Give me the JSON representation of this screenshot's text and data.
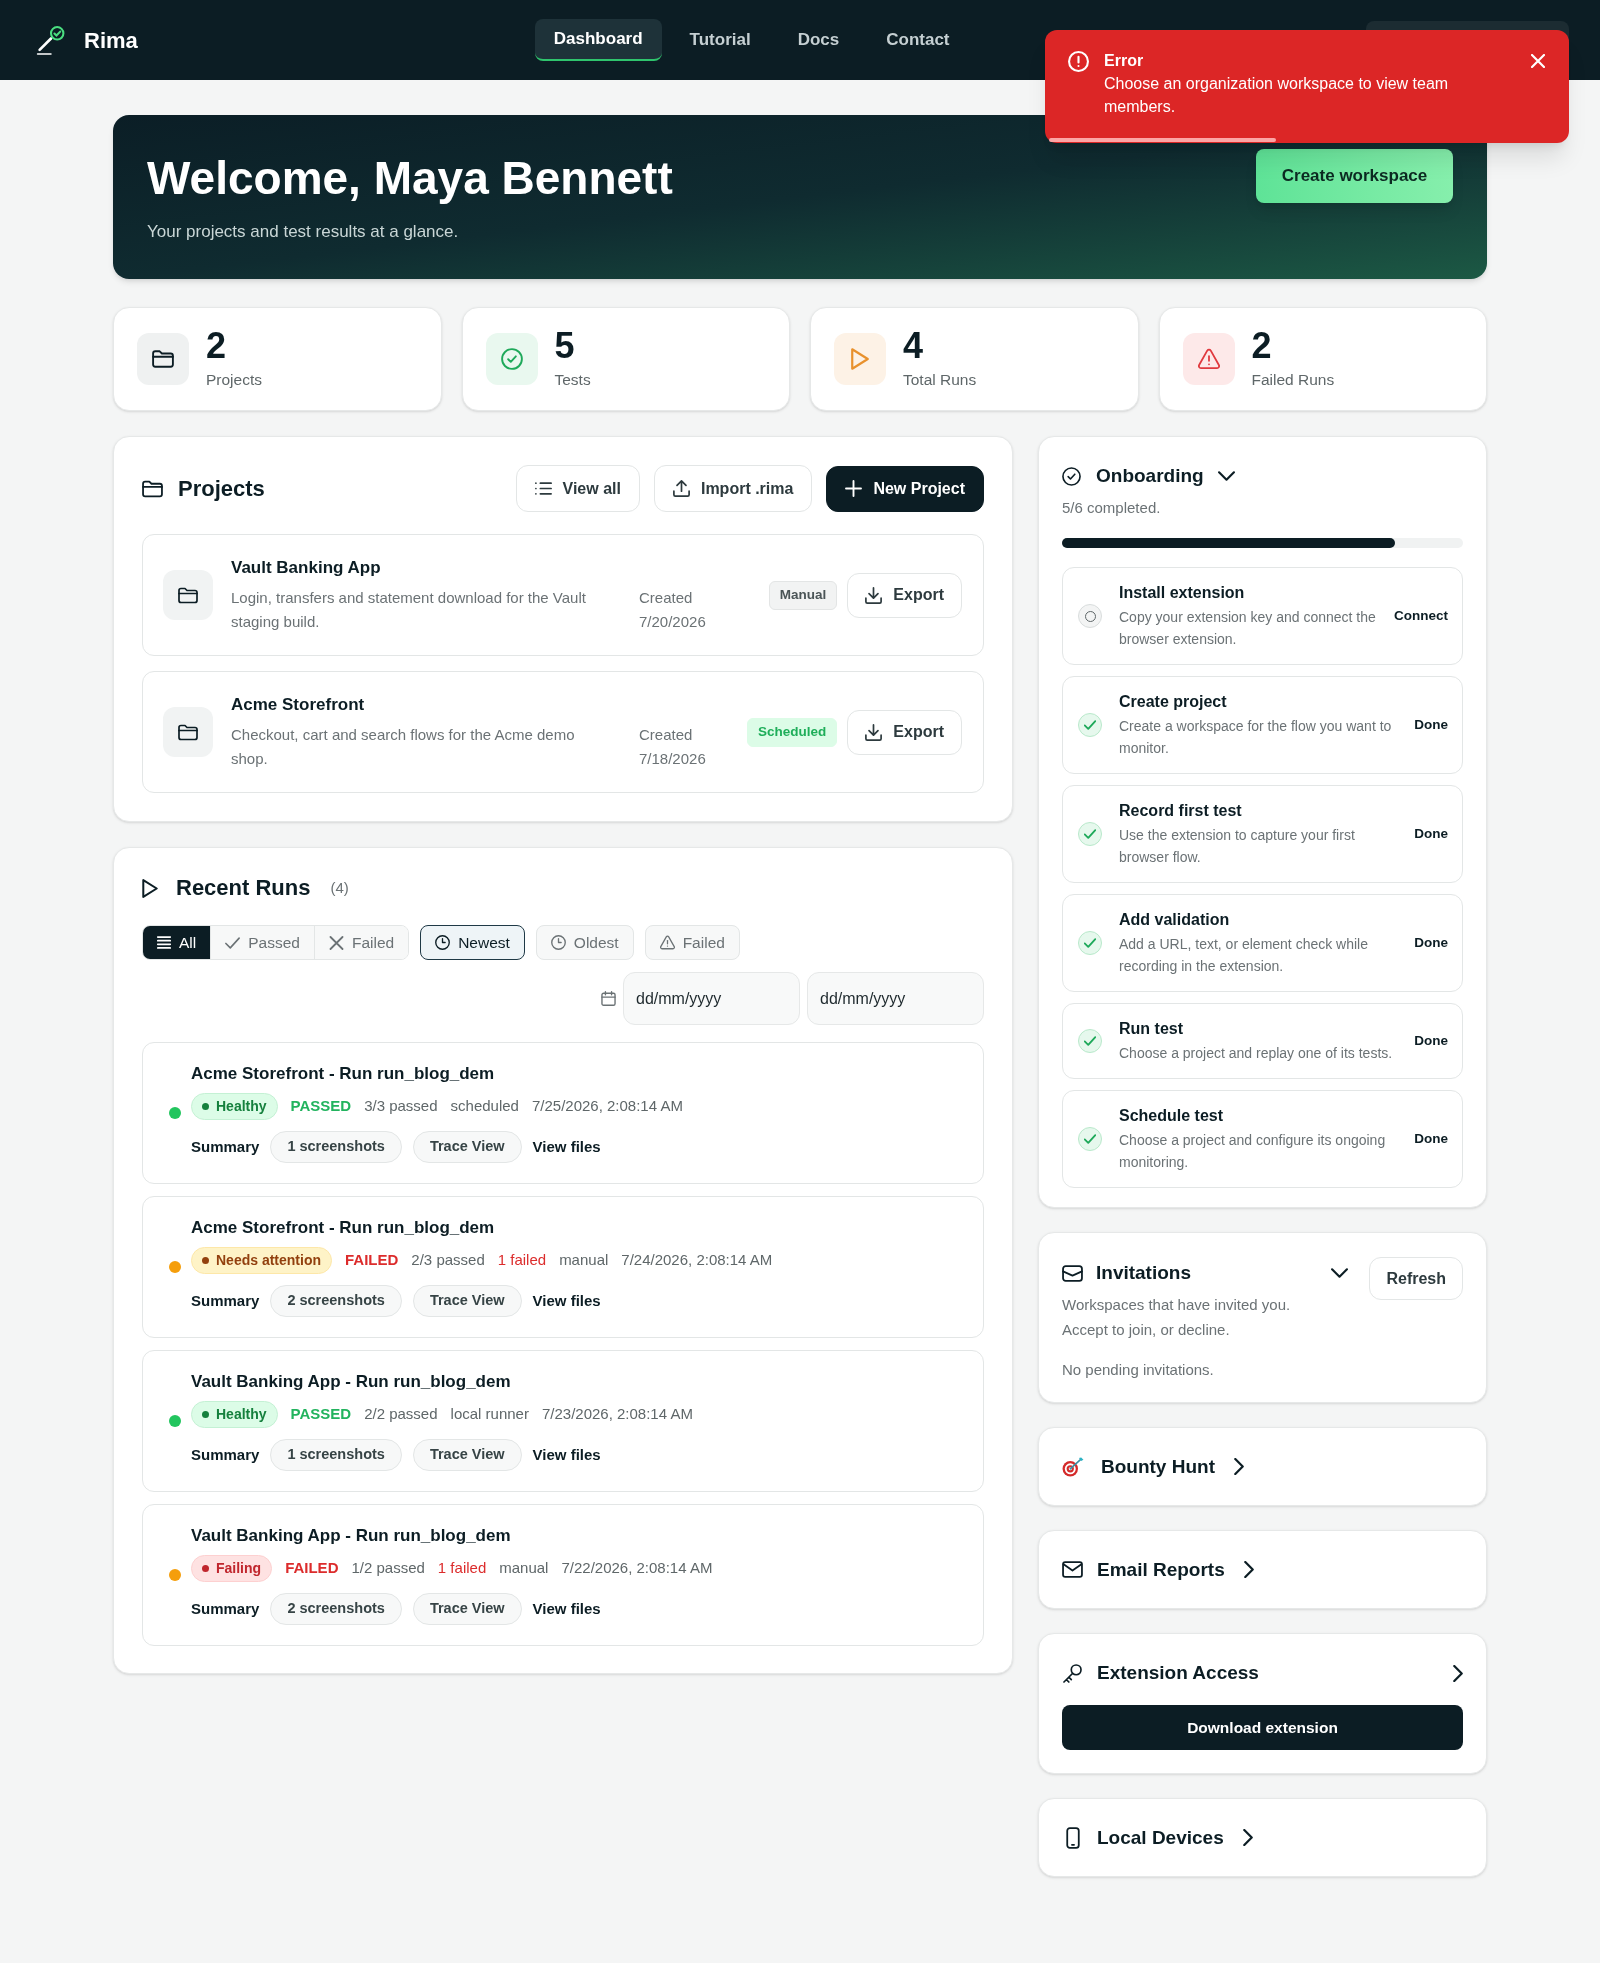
{
  "header": {
    "logo": "Rima",
    "nav": [
      {
        "label": "Dashboard",
        "selected": true
      },
      {
        "label": "Tutorial",
        "selected": false
      },
      {
        "label": "Docs",
        "selected": false
      },
      {
        "label": "Contact",
        "selected": false
      }
    ]
  },
  "toast": {
    "title": "Error",
    "message": "Choose an organization workspace to view team members.",
    "level": 0.44
  },
  "hero": {
    "title": "Welcome, Maya Bennett",
    "subtitle": "Your projects and test results at a glance.",
    "button": "Create workspace"
  },
  "stats": [
    {
      "kind": "projects",
      "value": "2",
      "label": "Projects"
    },
    {
      "kind": "tests",
      "value": "5",
      "label": "Tests"
    },
    {
      "kind": "runs",
      "value": "4",
      "label": "Total Runs"
    },
    {
      "kind": "failed",
      "value": "2",
      "label": "Failed Runs"
    }
  ],
  "projects": {
    "title": "Projects",
    "buttons": [
      {
        "kind": "list",
        "label": "View all"
      },
      {
        "kind": "import",
        "label": "Import .rima"
      },
      {
        "kind": "new",
        "label": "New Project"
      }
    ],
    "items": [
      {
        "name": "Vault Banking App",
        "description": "Login, transfers and statement download for the Vault staging build.",
        "created": "Created 7/20/2026",
        "badge": {
          "kind": "manual",
          "label": "Manual"
        },
        "export": "Export"
      },
      {
        "name": "Acme Storefront",
        "description": "Checkout, cart and search flows for the Acme demo shop.",
        "created": "Created 7/18/2026",
        "badge": {
          "kind": "scheduled",
          "label": "Scheduled"
        },
        "export": "Export"
      }
    ]
  },
  "runs": {
    "title": "Recent Runs",
    "count": "(4)",
    "filters": [
      {
        "kind": "all",
        "label": "All",
        "selected": true
      },
      {
        "kind": "passed",
        "label": "Passed",
        "selected": false
      },
      {
        "kind": "failed",
        "label": "Failed",
        "selected": false
      }
    ],
    "options": [
      {
        "kind": "newest",
        "label": "Newest",
        "selected": true
      },
      {
        "kind": "oldest",
        "label": "Oldest",
        "selected": false
      },
      {
        "kind": "failed",
        "label": "Failed",
        "selected": false
      }
    ],
    "date_from": {
      "placeholder": "dd/mm/yyyy"
    },
    "date_to": {
      "placeholder": "dd/mm/yyyy"
    },
    "items": [
      {
        "title": "Acme Storefront - Run run_blog_dem",
        "color": "#22c55e",
        "health": {
          "kind": "healthy",
          "label": "Healthy"
        },
        "result": {
          "kind": "passed",
          "label": "PASSED"
        },
        "passed": "3/3 passed",
        "trigger": "scheduled",
        "time": "7/25/2026, 2:08:14 AM",
        "summary": "Summary",
        "screenshots": "1 screenshots",
        "trace": "Trace View",
        "files": "View files"
      },
      {
        "title": "Acme Storefront - Run run_blog_dem",
        "color": "#f59e0b",
        "health": {
          "kind": "attention",
          "label": "Needs attention"
        },
        "result": {
          "kind": "failed",
          "label": "FAILED"
        },
        "passed": "2/3 passed",
        "failed": "1 failed",
        "trigger": "manual",
        "time": "7/24/2026, 2:08:14 AM",
        "summary": "Summary",
        "screenshots": "2 screenshots",
        "trace": "Trace View",
        "files": "View files"
      },
      {
        "title": "Vault Banking App - Run run_blog_dem",
        "color": "#22c55e",
        "health": {
          "kind": "healthy",
          "label": "Healthy"
        },
        "result": {
          "kind": "passed",
          "label": "PASSED"
        },
        "passed": "2/2 passed",
        "trigger": "local runner",
        "time": "7/23/2026, 2:08:14 AM",
        "summary": "Summary",
        "screenshots": "1 screenshots",
        "trace": "Trace View",
        "files": "View files"
      },
      {
        "title": "Vault Banking App - Run run_blog_dem",
        "color": "#f59e0b",
        "health": {
          "kind": "failing",
          "label": "Failing"
        },
        "result": {
          "kind": "failed",
          "label": "FAILED"
        },
        "passed": "1/2 passed",
        "failed": "1 failed",
        "trigger": "manual",
        "time": "7/22/2026, 2:08:14 AM",
        "summary": "Summary",
        "screenshots": "2 screenshots",
        "trace": "Trace View",
        "files": "View files"
      }
    ]
  },
  "onboarding": {
    "title": "Onboarding",
    "expanded": true,
    "progress": "5/6 completed.",
    "level": 0.83,
    "steps": [
      {
        "title": "Install extension",
        "description": "Copy your extension key and connect the browser extension.",
        "action": "Connect",
        "done": false
      },
      {
        "title": "Create project",
        "description": "Create a workspace for the flow you want to monitor.",
        "action": "Done",
        "done": true
      },
      {
        "title": "Record first test",
        "description": "Use the extension to capture your first browser flow.",
        "action": "Done",
        "done": true
      },
      {
        "title": "Add validation",
        "description": "Add a URL, text, or element check while recording in the extension.",
        "action": "Done",
        "done": true
      },
      {
        "title": "Run test",
        "description": "Choose a project and replay one of its tests.",
        "action": "Done",
        "done": true
      },
      {
        "title": "Schedule test",
        "description": "Choose a project and configure its ongoing monitoring.",
        "action": "Done",
        "done": true
      }
    ]
  },
  "invitations": {
    "title": "Invitations",
    "expanded": true,
    "button": "Refresh",
    "description": "Workspaces that have invited you. Accept to join, or decline.",
    "empty": "No pending invitations."
  },
  "links": [
    {
      "kind": "bounty",
      "label": "Bounty Hunt"
    },
    {
      "kind": "email",
      "label": "Email Reports"
    },
    {
      "kind": "extension",
      "label": "Extension Access",
      "button": "Download extension"
    },
    {
      "kind": "devices",
      "label": "Local Devices"
    }
  ]
}
